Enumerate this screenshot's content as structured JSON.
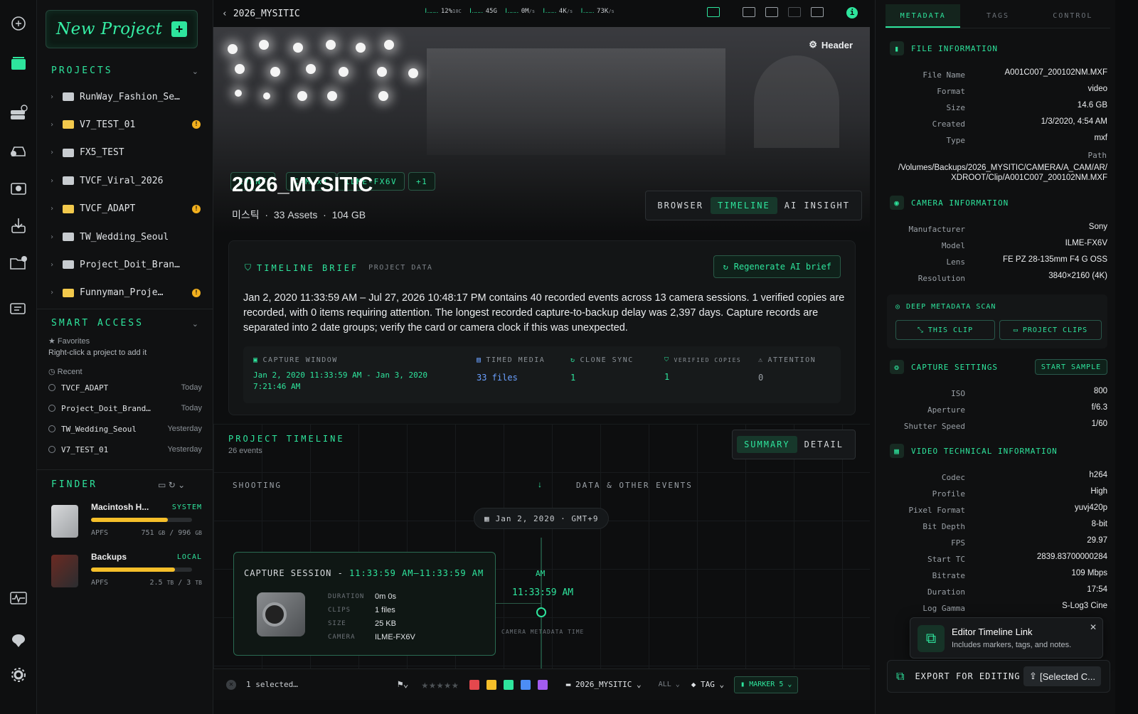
{
  "rail": {
    "icons": [
      "brain-icon",
      "stack-icon",
      "drive-icon",
      "car-icon",
      "camera-icon",
      "download-icon",
      "folder-help-icon",
      "chat-icon",
      "activity-icon",
      "brain-bolt-icon",
      "gear-icon"
    ]
  },
  "sidebar": {
    "new_project": "New Project",
    "projects_title": "PROJECTS",
    "projects": [
      {
        "name": "RunWay_Fashion_Se…",
        "yellow": false,
        "alert": false
      },
      {
        "name": "V7_TEST_01",
        "yellow": true,
        "alert": true
      },
      {
        "name": "FX5_TEST",
        "yellow": false,
        "alert": false
      },
      {
        "name": "TVCF_Viral_2026",
        "yellow": false,
        "alert": false
      },
      {
        "name": "TVCF_ADAPT",
        "yellow": true,
        "alert": true
      },
      {
        "name": "TW_Wedding_Seoul",
        "yellow": false,
        "alert": false
      },
      {
        "name": "Project_Doit_Bran…",
        "yellow": false,
        "alert": false
      },
      {
        "name": "Funnyman_Proje…",
        "yellow": true,
        "alert": true
      }
    ],
    "alert_mark": "!",
    "smart_title": "SMART ACCESS",
    "favorites_label": "Favorites",
    "favorites_hint": "Right-click a project to add it",
    "recent_label": "Recent",
    "recent": [
      {
        "name": "TVCF_ADAPT",
        "time": "Today"
      },
      {
        "name": "Project_Doit_Brand…",
        "time": "Today"
      },
      {
        "name": "TW_Wedding_Seoul",
        "time": "Yesterday"
      },
      {
        "name": "V7_TEST_01",
        "time": "Yesterday"
      }
    ],
    "finder_title": "FINDER",
    "drives": [
      {
        "name": "Macintosh H...",
        "tag": "SYSTEM",
        "fs": "APFS",
        "used": "751",
        "used_unit": "GB",
        "total": "996",
        "total_unit": "GB",
        "fill": 0.76
      },
      {
        "name": "Backups",
        "tag": "LOCAL",
        "fs": "APFS",
        "used": "2.5",
        "used_unit": "TB",
        "total": "3",
        "total_unit": "TB",
        "fill": 0.83
      }
    ]
  },
  "topbar": {
    "title": "2026_MYSITIC",
    "meters": [
      {
        "value": "12%",
        "unit": "10C"
      },
      {
        "value": "45G",
        "unit": ""
      },
      {
        "value": "0M",
        "unit": "/s"
      },
      {
        "value": "4K",
        "unit": "/s"
      },
      {
        "value": "73K",
        "unit": "/s"
      }
    ]
  },
  "hero": {
    "header_label": "Header",
    "chips": [
      "EVENT",
      "CAM x1",
      "ILME-FX6V",
      "+1"
    ],
    "title": "2026_MYSITIC",
    "sub_name": "미스틱",
    "assets": "33 Assets",
    "size": "104 GB",
    "views": [
      "BROWSER",
      "TIMELINE",
      "AI INSIGHT"
    ],
    "active_view": 1
  },
  "brief": {
    "title": "TIMELINE BRIEF",
    "sub": "PROJECT DATA",
    "regen": "Regenerate AI brief",
    "text": "Jan 2, 2020 11:33:59 AM – Jul 27, 2026 10:48:17 PM contains 40 recorded events across 13 camera sessions. 1 verified copies are recorded, with 0 items requiring attention. The longest recorded capture-to-backup delay was 2,397 days. Capture records are separated into 2 date groups; verify the card or camera clock if this was unexpected.",
    "stats": {
      "capture_h": "CAPTURE WINDOW",
      "capture_v1": "Jan 2, 2020 11:33:59 AM - Jan 3, 2020",
      "capture_v2": "7:21:46 AM",
      "timed_h": "TIMED MEDIA",
      "timed_v": "33 files",
      "clone_h": "CLONE SYNC",
      "clone_v": "1",
      "verified_h": "VERIFIED COPIES",
      "verified_v": "1",
      "attention_h": "ATTENTION",
      "attention_v": "0"
    }
  },
  "timeline": {
    "title": "PROJECT TIMELINE",
    "count": "26 events",
    "modes": [
      "SUMMARY",
      "DETAIL"
    ],
    "lane_left": "SHOOTING",
    "lane_right": "DATA & OTHER EVENTS",
    "date_pill": "Jan 2, 2020 · GMT+9",
    "session_label": "CAPTURE SESSION - ",
    "session_time": "11:33:59 AM–11:33:59 AM",
    "session_fields": [
      {
        "k": "DURATION",
        "v": "0m 0s"
      },
      {
        "k": "CLIPS",
        "v": "1 files"
      },
      {
        "k": "SIZE",
        "v": "25 KB"
      },
      {
        "k": "CAMERA",
        "v": "ILME-FX6V"
      }
    ],
    "marker_ampm": "AM",
    "marker_time": "11:33:59 AM",
    "marker_caption": "CAMERA METADATA TIME"
  },
  "bottombar": {
    "selected": "1 selected…",
    "folder": "2026_MYSITIC",
    "all": "ALL",
    "tag": "TAG",
    "marker": "MARKER",
    "marker_count": "5",
    "swatches": [
      "#e5484d",
      "#f5bf2a",
      "#2ee59d",
      "#4c8df6",
      "#a35cf0"
    ]
  },
  "right": {
    "tabs": [
      "METADATA",
      "TAGS",
      "CONTROL"
    ],
    "file_title": "FILE INFORMATION",
    "file": [
      {
        "k": "File Name",
        "v": "A001C007_200102NM.MXF"
      },
      {
        "k": "Format",
        "v": "video"
      },
      {
        "k": "Size",
        "v": "14.6 GB"
      },
      {
        "k": "Created",
        "v": "1/3/2020, 4:54 AM"
      },
      {
        "k": "Type",
        "v": "mxf"
      }
    ],
    "path_k": "Path",
    "path_v": "/Volumes/Backups/2026_MYSITIC/CAMERA/A_CAM/AR/XDROOT/Clip/A001C007_200102NM.MXF",
    "camera_title": "CAMERA INFORMATION",
    "camera": [
      {
        "k": "Manufacturer",
        "v": "Sony"
      },
      {
        "k": "Model",
        "v": "ILME-FX6V"
      },
      {
        "k": "Lens",
        "v": "FE PZ 28-135mm F4 G OSS"
      },
      {
        "k": "Resolution",
        "v": "3840×2160 (4K)"
      }
    ],
    "deep_title": "DEEP METADATA SCAN",
    "this_clip": "THIS CLIP",
    "project_clips": "PROJECT CLIPS",
    "capture_title": "CAPTURE SETTINGS",
    "start_sample": "START SAMPLE",
    "capture": [
      {
        "k": "ISO",
        "v": "800"
      },
      {
        "k": "Aperture",
        "v": "f/6.3"
      },
      {
        "k": "Shutter Speed",
        "v": "1/60"
      }
    ],
    "video_title": "VIDEO TECHNICAL INFORMATION",
    "video": [
      {
        "k": "Codec",
        "v": "h264"
      },
      {
        "k": "Profile",
        "v": "High"
      },
      {
        "k": "Pixel Format",
        "v": "yuvj420p"
      },
      {
        "k": "Bit Depth",
        "v": "8-bit"
      },
      {
        "k": "FPS",
        "v": "29.97"
      },
      {
        "k": "Start TC",
        "v": "2839.83700000284"
      },
      {
        "k": "Bitrate",
        "v": "109 Mbps"
      },
      {
        "k": "Duration",
        "v": "17:54"
      },
      {
        "k": "Log Gamma",
        "v": "S-Log3 Cine"
      }
    ],
    "toast_title": "Editor Timeline Link",
    "toast_sub": "Includes markers, tags, and notes.",
    "export": "EXPORT FOR EDITING",
    "export_sel": "[Selected C..."
  }
}
